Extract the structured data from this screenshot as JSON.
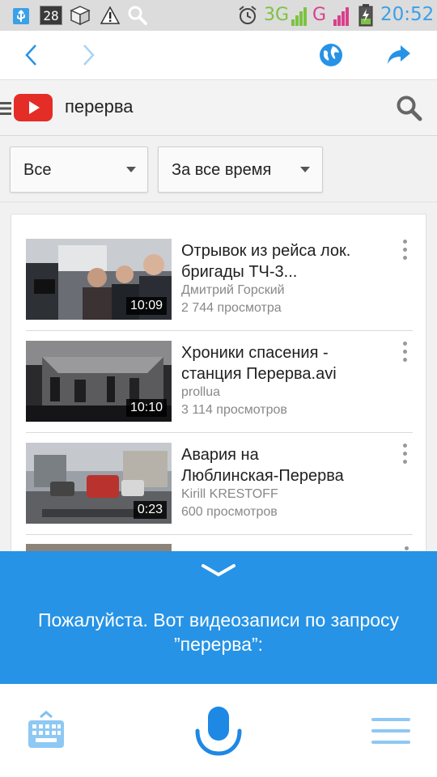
{
  "status_bar": {
    "notification_count": "28",
    "network_type": "3G",
    "network_g": "G",
    "time": "20:52",
    "icons": [
      "usb-icon",
      "box-icon",
      "warning-icon",
      "search-icon",
      "alarm-icon",
      "signal-icon",
      "battery-charging-icon"
    ]
  },
  "browser": {
    "back_icon": "chevron-left-icon",
    "forward_icon": "chevron-right-icon",
    "globe_icon": "globe-icon",
    "share_icon": "share-arrow-icon"
  },
  "youtube": {
    "query": "перерва",
    "search_icon": "search-icon"
  },
  "filters": {
    "type": "Все",
    "period": "За все время"
  },
  "videos": [
    {
      "title": "Отрывок из рейса лок. бригады ТЧ-3...",
      "channel": "Дмитрий Горский",
      "views": "2 744 просмотра",
      "duration": "10:09"
    },
    {
      "title": "Хроники спасения - станция Перерва.avi",
      "channel": "prollua",
      "views": "3 114 просмотров",
      "duration": "10:10"
    },
    {
      "title": "Авария на Люблинская-Перерва",
      "channel": "Kirill KRESTOFF",
      "views": "600 просмотров",
      "duration": "0:23"
    }
  ],
  "assistant": {
    "message": "Пожалуйста. Вот видеозаписи по запросу ”перерва”:"
  },
  "bottom_bar": {
    "keyboard_icon": "keyboard-icon",
    "mic_icon": "microphone-icon",
    "menu_icon": "menu-icon"
  },
  "colors": {
    "accent_blue": "#2693e6",
    "youtube_red": "#e52d27",
    "status_green": "#7dc242",
    "status_pink": "#d93f8d"
  }
}
